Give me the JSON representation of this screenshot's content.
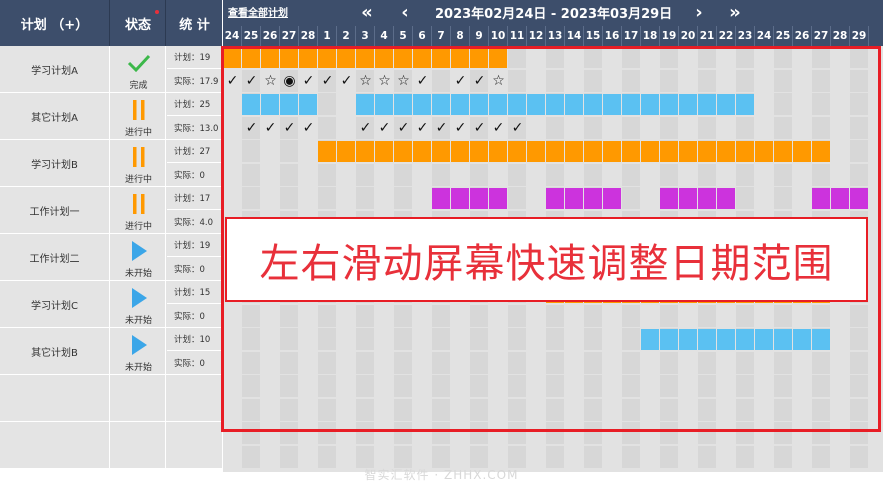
{
  "header": {
    "plan_col": "计划 （+）",
    "status_col": "状态",
    "stat_col": "统 计",
    "view_all": "查看全部计划",
    "nav_first": "«",
    "nav_prev": "‹",
    "nav_next": "›",
    "nav_last": "»",
    "date_range": "2023年02月24日 - 2023年03月29日",
    "days": [
      "24",
      "25",
      "26",
      "27",
      "28",
      "1",
      "2",
      "3",
      "4",
      "5",
      "6",
      "7",
      "8",
      "9",
      "10",
      "11",
      "12",
      "13",
      "14",
      "15",
      "16",
      "17",
      "18",
      "19",
      "20",
      "21",
      "22",
      "23",
      "24",
      "25",
      "26",
      "27",
      "28",
      "29"
    ]
  },
  "plans": [
    {
      "name": "学习计划A",
      "status": "完成",
      "status_icon": "check-icon",
      "plan_label": "计划：19",
      "actual_label": "实际：17.9"
    },
    {
      "name": "其它计划A",
      "status": "进行中",
      "status_icon": "pause-icon",
      "plan_label": "计划：25",
      "actual_label": "实际：13.0"
    },
    {
      "name": "学习计划B",
      "status": "进行中",
      "status_icon": "pause-icon",
      "plan_label": "计划：27",
      "actual_label": "实际：0"
    },
    {
      "name": "工作计划一",
      "status": "进行中",
      "status_icon": "pause-icon",
      "plan_label": "计划：17",
      "actual_label": "实际：4.0"
    },
    {
      "name": "工作计划二",
      "status": "未开始",
      "status_icon": "play-icon",
      "plan_label": "计划：19",
      "actual_label": "实际：0"
    },
    {
      "name": "学习计划C",
      "status": "未开始",
      "status_icon": "play-icon",
      "plan_label": "计划：15",
      "actual_label": "实际：0"
    },
    {
      "name": "其它计划B",
      "status": "未开始",
      "status_icon": "play-icon",
      "plan_label": "计划：10",
      "actual_label": "实际：0"
    }
  ],
  "bars": [
    {
      "row": 0,
      "color": "#ff9900",
      "days": [
        0,
        1,
        2,
        3,
        4,
        5,
        6,
        7,
        8,
        9,
        10,
        11,
        12,
        13,
        14
      ]
    },
    {
      "row": 1,
      "color": "#5bc1f2",
      "days": [
        1,
        2,
        3,
        4,
        7,
        8,
        9,
        10,
        11,
        12,
        13,
        14,
        15,
        16,
        17,
        18,
        19,
        20,
        21,
        22,
        23,
        24,
        25,
        26,
        27
      ]
    },
    {
      "row": 2,
      "color": "#ff9900",
      "days": [
        5,
        6,
        7,
        8,
        9,
        10,
        11,
        12,
        13,
        14,
        15,
        16,
        17,
        18,
        19,
        20,
        21,
        22,
        23,
        24,
        25,
        26,
        27,
        28,
        29,
        30,
        31
      ]
    },
    {
      "row": 3,
      "color": "#cc33dd",
      "days": [
        11,
        12,
        13,
        14,
        17,
        18,
        19,
        20,
        23,
        24,
        25,
        26,
        31,
        32,
        33
      ]
    },
    {
      "row": 4,
      "color": "#cc33dd",
      "days": [
        33
      ]
    },
    {
      "row": 5,
      "color": "#ff9900",
      "days": [
        17,
        18,
        19,
        20,
        21,
        22,
        23,
        24,
        25,
        26,
        27,
        28,
        29,
        30,
        31
      ]
    },
    {
      "row": 6,
      "color": "#5bc1f2",
      "days": [
        22,
        23,
        24,
        25,
        26,
        27,
        28,
        29,
        30,
        31
      ]
    }
  ],
  "marks": [
    {
      "row": 0,
      "day": 0,
      "symbol": "✓"
    },
    {
      "row": 0,
      "day": 1,
      "symbol": "✓"
    },
    {
      "row": 0,
      "day": 2,
      "symbol": "☆"
    },
    {
      "row": 0,
      "day": 3,
      "symbol": "◉"
    },
    {
      "row": 0,
      "day": 4,
      "symbol": "✓"
    },
    {
      "row": 0,
      "day": 5,
      "symbol": "✓"
    },
    {
      "row": 0,
      "day": 6,
      "symbol": "✓"
    },
    {
      "row": 0,
      "day": 7,
      "symbol": "☆"
    },
    {
      "row": 0,
      "day": 8,
      "symbol": "☆"
    },
    {
      "row": 0,
      "day": 9,
      "symbol": "☆"
    },
    {
      "row": 0,
      "day": 10,
      "symbol": "✓"
    },
    {
      "row": 0,
      "day": 12,
      "symbol": "✓"
    },
    {
      "row": 0,
      "day": 13,
      "symbol": "✓"
    },
    {
      "row": 0,
      "day": 14,
      "symbol": "☆"
    },
    {
      "row": 1,
      "day": 1,
      "symbol": "✓"
    },
    {
      "row": 1,
      "day": 2,
      "symbol": "✓"
    },
    {
      "row": 1,
      "day": 3,
      "symbol": "✓"
    },
    {
      "row": 1,
      "day": 4,
      "symbol": "✓"
    },
    {
      "row": 1,
      "day": 7,
      "symbol": "✓"
    },
    {
      "row": 1,
      "day": 8,
      "symbol": "✓"
    },
    {
      "row": 1,
      "day": 9,
      "symbol": "✓"
    },
    {
      "row": 1,
      "day": 10,
      "symbol": "✓"
    },
    {
      "row": 1,
      "day": 11,
      "symbol": "✓"
    },
    {
      "row": 1,
      "day": 12,
      "symbol": "✓"
    },
    {
      "row": 1,
      "day": 13,
      "symbol": "✓"
    },
    {
      "row": 1,
      "day": 14,
      "symbol": "✓"
    },
    {
      "row": 1,
      "day": 15,
      "symbol": "✓"
    }
  ],
  "overlay": {
    "banner_text": "左右滑动屏幕快速调整日期范围"
  },
  "watermark": "智实汇软件 · ZHHX.COM",
  "colors": {
    "header_bg": "#3d4e6b",
    "accent_red": "#e81d25",
    "orange": "#ff9900",
    "blue": "#5bc1f2",
    "purple": "#cc33dd",
    "check_green": "#3cb84a",
    "pause_orange": "#ff9900",
    "play_blue": "#3ba6e8"
  }
}
